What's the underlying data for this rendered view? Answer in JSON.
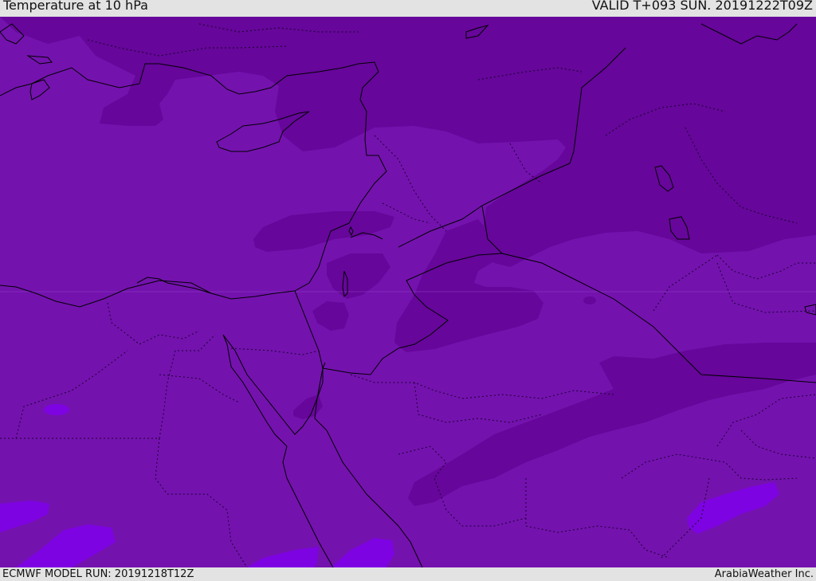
{
  "header": {
    "title": "Temperature at 10 hPa",
    "valid_time": "VALID T+093 SUN. 20191222T09Z"
  },
  "footer": {
    "model_run": "ECMWF MODEL RUN: 20191218T12Z",
    "credit": "ArabiaWeather Inc."
  },
  "map": {
    "colors": {
      "base": "#7412ae",
      "cold_band": "#66069a",
      "warm_spot": "#7e03e2",
      "coastline": "#000000",
      "border": "#000000"
    }
  }
}
